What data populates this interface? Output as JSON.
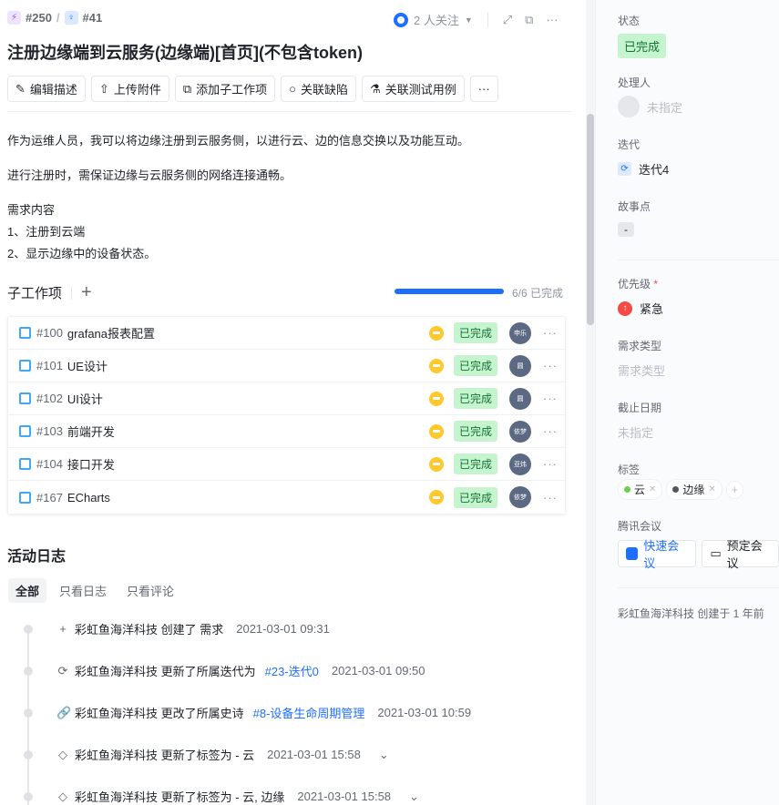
{
  "breadcrumb": {
    "parent_id": "#250",
    "current_id": "#41",
    "sep": "/"
  },
  "header": {
    "followers": "2 人关注",
    "more": "···"
  },
  "title": "注册边缘端到云服务(边缘端)[首页](不包含token)",
  "toolbar": [
    {
      "icon": "pencil-icon",
      "label": "编辑描述"
    },
    {
      "icon": "upload-icon",
      "label": "上传附件"
    },
    {
      "icon": "subitem-icon",
      "label": "添加子工作项"
    },
    {
      "icon": "bug-icon",
      "label": "关联缺陷"
    },
    {
      "icon": "flask-icon",
      "label": "关联测试用例"
    }
  ],
  "toolbar_more": "···",
  "description": {
    "p1": "作为运维人员，我可以将边缘注册到云服务侧，以进行云、边的信息交换以及功能互动。",
    "p2": "进行注册时，需保证边缘与云服务侧的网络连接通畅。",
    "p3a": "需求内容",
    "p3b": "1、注册到云端",
    "p3c": "2、显示边缘中的设备状态。"
  },
  "subitems": {
    "title": "子工作项",
    "add": "+",
    "progress": 1.0,
    "progress_text": "6/6 已完成",
    "items": [
      {
        "id": "#100",
        "name": "grafana报表配置",
        "status": "已完成",
        "assignee": "申乐"
      },
      {
        "id": "#101",
        "name": "UE设计",
        "status": "已完成",
        "assignee": "圆"
      },
      {
        "id": "#102",
        "name": "UI设计",
        "status": "已完成",
        "assignee": "圆"
      },
      {
        "id": "#103",
        "name": "前端开发",
        "status": "已完成",
        "assignee": "依梦"
      },
      {
        "id": "#104",
        "name": "接口开发",
        "status": "已完成",
        "assignee": "亚炜"
      },
      {
        "id": "#167",
        "name": "ECharts",
        "status": "已完成",
        "assignee": "依梦"
      }
    ],
    "more": "···"
  },
  "activity": {
    "title": "活动日志",
    "tabs": [
      "全部",
      "只看日志",
      "只看评论"
    ],
    "entries": [
      {
        "icon": "+",
        "text": "彩虹鱼海洋科技 创建了 需求",
        "link": "",
        "time": "2021-03-01 09:31",
        "chev": ""
      },
      {
        "icon": "⟳",
        "text": "彩虹鱼海洋科技 更新了所属迭代为",
        "link": "#23-迭代0",
        "time": "2021-03-01 09:50",
        "chev": ""
      },
      {
        "icon": "🔗",
        "text": "彩虹鱼海洋科技 更改了所属史诗",
        "link": "#8-设备生命周期管理",
        "time": "2021-03-01 10:59",
        "chev": ""
      },
      {
        "icon": "◇",
        "text": "彩虹鱼海洋科技 更新了标签为 - 云",
        "link": "",
        "time": "2021-03-01 15:58",
        "chev": "⌄"
      },
      {
        "icon": "◇",
        "text": "彩虹鱼海洋科技 更新了标签为 - 云, 边缘",
        "link": "",
        "time": "2021-03-01 15:58",
        "chev": "⌄"
      }
    ]
  },
  "sidebar": {
    "status_label": "状态",
    "status": "已完成",
    "assignee_label": "处理人",
    "assignee": "未指定",
    "iteration_label": "迭代",
    "iteration": "迭代4",
    "points_label": "故事点",
    "points": "-",
    "priority_label": "优先级",
    "required": "*",
    "priority": "紧急",
    "type_label": "需求类型",
    "type": "需求类型",
    "due_label": "截止日期",
    "due": "未指定",
    "tags_label": "标签",
    "tags": [
      {
        "name": "云",
        "color": "#6ad150"
      },
      {
        "name": "边缘",
        "color": "#51565d"
      }
    ],
    "tag_add": "+",
    "meeting_label": "腾讯会议",
    "quick_meeting": "快速会议",
    "schedule_meeting": "预定会议",
    "created": "彩虹鱼海洋科技 创建于 1 年前"
  }
}
